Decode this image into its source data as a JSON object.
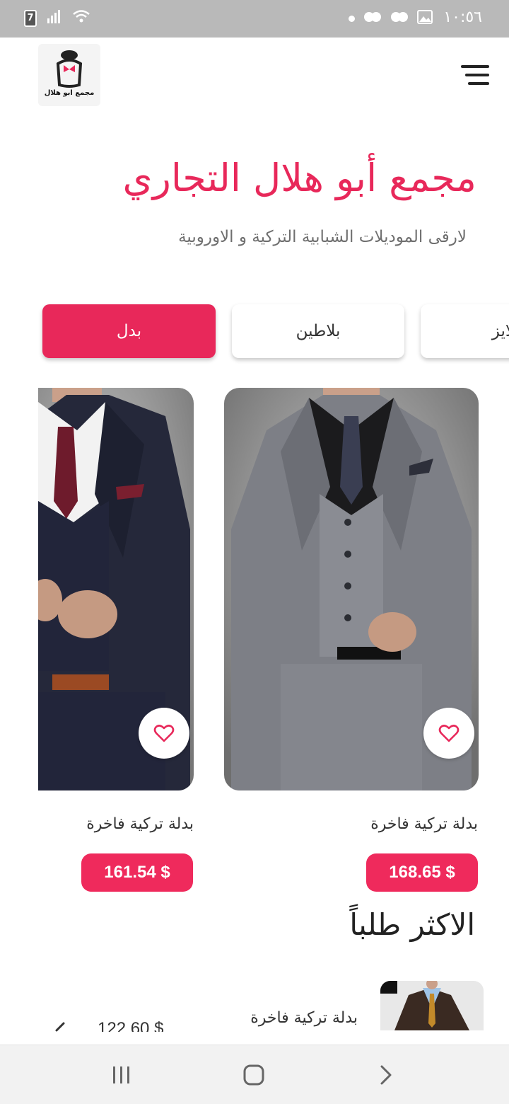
{
  "status_bar": {
    "time": "١٠:٥٦",
    "battery_badge": "7"
  },
  "header": {
    "logo_text": "مجمع ابو هلال"
  },
  "hero": {
    "title": "مجمع أبو هلال التجاري",
    "subtitle": "لارقى الموديلات الشبابية التركية و الاوروبية"
  },
  "categories": {
    "tabs": [
      {
        "label": "بدل",
        "active": true
      },
      {
        "label": "بلاطين",
        "active": false
      },
      {
        "label": "بلايز",
        "active": false
      }
    ]
  },
  "products": [
    {
      "name": "بدلة تركية فاخرة",
      "price": "168.65 $"
    },
    {
      "name": "بدلة تركية فاخرة",
      "price": "161.54 $"
    }
  ],
  "most_requested": {
    "title": "الاكثر طلباً",
    "items": [
      {
        "name": "بدلة تركية فاخرة",
        "price": "122.60 $"
      }
    ]
  },
  "colors": {
    "accent": "#e8285a",
    "price_bg": "#ef2a5c",
    "status_bar": "#b9b9b9"
  }
}
